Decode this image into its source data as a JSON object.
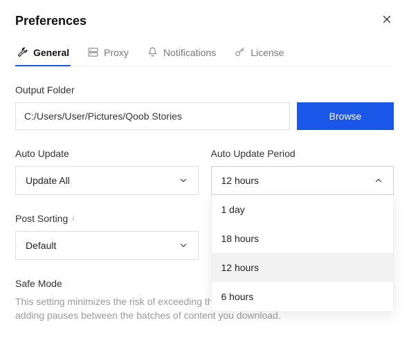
{
  "title": "Preferences",
  "tabs": {
    "general": "General",
    "proxy": "Proxy",
    "notifications": "Notifications",
    "license": "License"
  },
  "outputFolder": {
    "label": "Output Folder",
    "value": "C:/Users/User/Pictures/Qoob Stories",
    "browse": "Browse"
  },
  "autoUpdate": {
    "label": "Auto Update",
    "value": "Update All"
  },
  "autoUpdatePeriod": {
    "label": "Auto Update Period",
    "value": "12 hours",
    "options": [
      "1 day",
      "18 hours",
      "12 hours",
      "6 hours"
    ]
  },
  "postSorting": {
    "label": "Post Sorting",
    "value": "Default"
  },
  "safeMode": {
    "title": "Safe Mode",
    "desc": "This setting minimizes the risk of exceeding the Instagram download limits by adding pauses between the batches of content you download."
  }
}
